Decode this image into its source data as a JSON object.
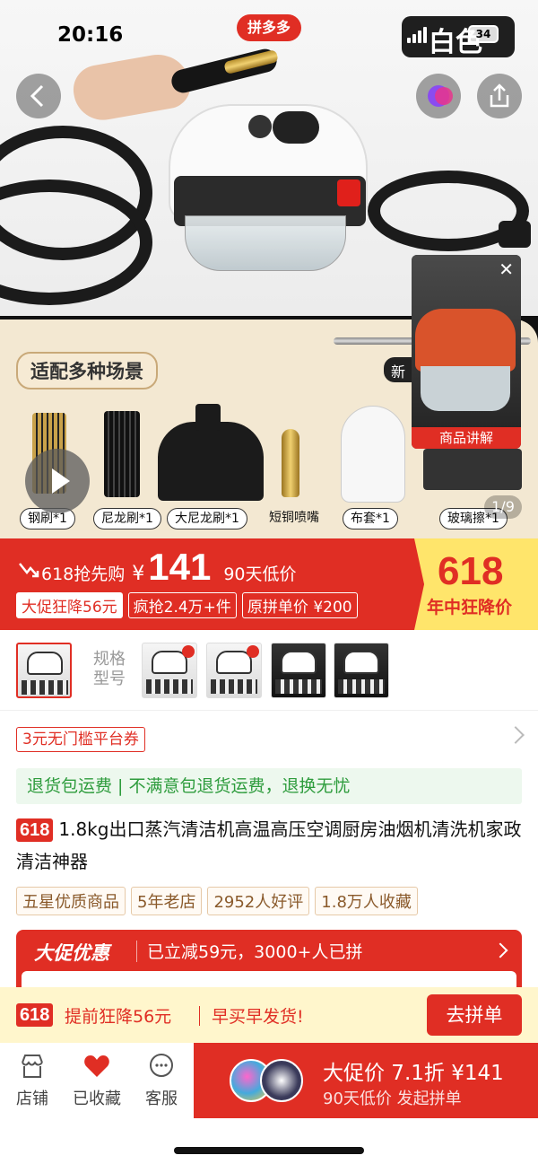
{
  "status_bar": {
    "time": "20:16",
    "app_badge": "拼多多",
    "network": "白色",
    "battery": "34"
  },
  "gallery": {
    "scene_tag": "适配多种场景",
    "xin_tag": "新",
    "accessories": [
      "钢刷*1",
      "尼龙刷*1",
      "大尼龙刷*1",
      "短铜喷嘴",
      "布套*1",
      "玻璃擦*1"
    ],
    "counter": "1/9",
    "video_label": "商品讲解",
    "close_glyph": "✕"
  },
  "price": {
    "rush_label": "618抢先购",
    "currency": "¥",
    "amount": "141",
    "low_label": "90天低价",
    "tags": [
      "大促狂降56元",
      "疯抢2.4万+件",
      "原拼单价 ¥200"
    ],
    "badge_big": "618",
    "badge_sub": "年中狂降价"
  },
  "sku": {
    "label": "规格型号"
  },
  "coupon": {
    "text": "3元无门槛平台券"
  },
  "return_policy": {
    "text": "退货包运费 | 不满意包退货运费，退换无忧"
  },
  "product": {
    "tag": "618",
    "title": "1.8kg出口蒸汽清洁机高温高压空调厨房油烟机清洗机家政清洁神器",
    "features": [
      "五星优质商品",
      "5年老店",
      "2952人好评",
      "1.8万人收藏"
    ]
  },
  "promo": {
    "title": "大促优惠",
    "text": "已立减59元，3000+人已拼"
  },
  "early": {
    "tag": "618",
    "text1": "提前狂降56元",
    "text2": "早买早发货!",
    "button": "去拼单"
  },
  "bottom_nav": {
    "shop": "店铺",
    "favorite": "已收藏",
    "service": "客服",
    "buy_main": "大促价 7.1折 ¥141",
    "buy_sub": "90天低价 发起拼单"
  },
  "colors": {
    "brand_red": "#e02e24",
    "promo_yellow": "#ffe56b",
    "return_green": "#2e9c3d"
  }
}
